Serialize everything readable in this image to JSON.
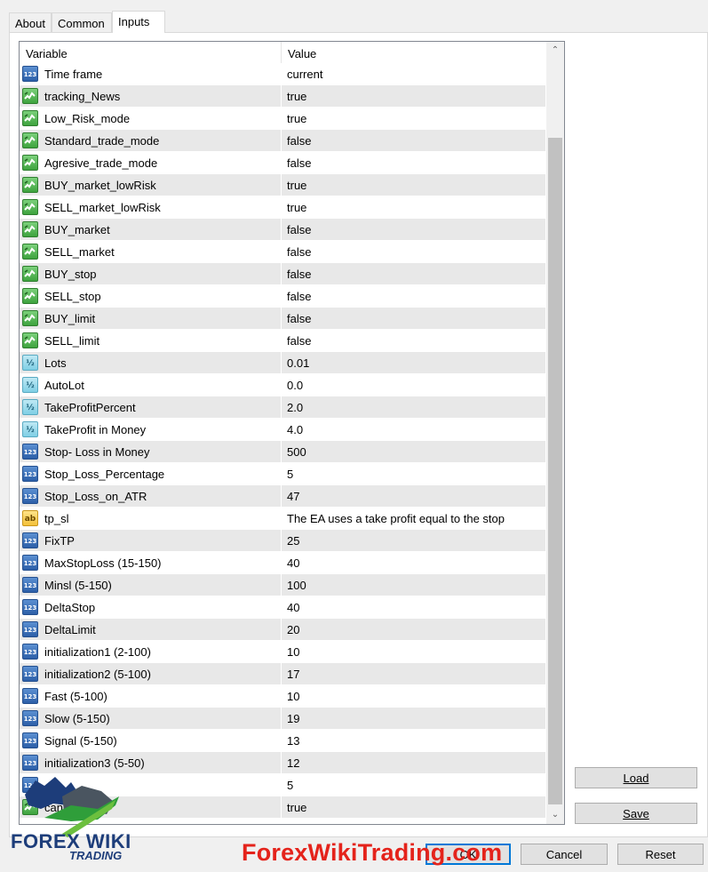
{
  "tabs": [
    "About",
    "Common",
    "Inputs"
  ],
  "table": {
    "headers": {
      "variable": "Variable",
      "value": "Value"
    },
    "rows": [
      {
        "icon": "int",
        "name": "Time frame",
        "value": "current"
      },
      {
        "icon": "bool",
        "name": "tracking_News",
        "value": "true"
      },
      {
        "icon": "bool",
        "name": "Low_Risk_mode",
        "value": "true"
      },
      {
        "icon": "bool",
        "name": "Standard_trade_mode",
        "value": "false"
      },
      {
        "icon": "bool",
        "name": "Agresive_trade_mode",
        "value": "false"
      },
      {
        "icon": "bool",
        "name": "BUY_market_lowRisk",
        "value": "true"
      },
      {
        "icon": "bool",
        "name": "SELL_market_lowRisk",
        "value": "true"
      },
      {
        "icon": "bool",
        "name": "BUY_market",
        "value": "false"
      },
      {
        "icon": "bool",
        "name": "SELL_market",
        "value": "false"
      },
      {
        "icon": "bool",
        "name": "BUY_stop",
        "value": "false"
      },
      {
        "icon": "bool",
        "name": "SELL_stop",
        "value": "false"
      },
      {
        "icon": "bool",
        "name": "BUY_limit",
        "value": "false"
      },
      {
        "icon": "bool",
        "name": "SELL_limit",
        "value": "false"
      },
      {
        "icon": "double",
        "name": "Lots",
        "value": "0.01"
      },
      {
        "icon": "double",
        "name": "AutoLot",
        "value": "0.0"
      },
      {
        "icon": "double",
        "name": "TakeProfitPercent",
        "value": "2.0"
      },
      {
        "icon": "double",
        "name": "TakeProfit in Money",
        "value": "4.0"
      },
      {
        "icon": "int",
        "name": "Stop- Loss in Money",
        "value": "500"
      },
      {
        "icon": "int",
        "name": "Stop_Loss_Percentage",
        "value": "5"
      },
      {
        "icon": "int",
        "name": "Stop_Loss_on_ATR",
        "value": "47"
      },
      {
        "icon": "string",
        "name": "tp_sl",
        "value": "The EA uses a take profit equal to the stop"
      },
      {
        "icon": "int",
        "name": "FixTP",
        "value": "25"
      },
      {
        "icon": "int",
        "name": "MaxStopLoss (15-150)",
        "value": "40"
      },
      {
        "icon": "int",
        "name": "Minsl (5-150)",
        "value": "100"
      },
      {
        "icon": "int",
        "name": "DeltaStop",
        "value": "40"
      },
      {
        "icon": "int",
        "name": "DeltaLimit",
        "value": "20"
      },
      {
        "icon": "int",
        "name": "initialization1 (2-100)",
        "value": "10"
      },
      {
        "icon": "int",
        "name": "initialization2 (5-100)",
        "value": "17"
      },
      {
        "icon": "int",
        "name": "Fast (5-100)",
        "value": "10"
      },
      {
        "icon": "int",
        "name": "Slow (5-150)",
        "value": "19"
      },
      {
        "icon": "int",
        "name": "Signal (5-150)",
        "value": "13"
      },
      {
        "icon": "int",
        "name": "initialization3 (5-50)",
        "value": "12"
      },
      {
        "icon": "int",
        "name": "",
        "value": "5"
      },
      {
        "icon": "bool",
        "name": "candle",
        "value": "true"
      }
    ]
  },
  "icon_glyphs": {
    "int": "123",
    "double": "½",
    "string": "ab"
  },
  "buttons": {
    "load": "Load",
    "save": "Save",
    "ok": "OK",
    "cancel": "Cancel",
    "reset": "Reset"
  },
  "watermark": {
    "text": "ForexWikiTrading.com",
    "logo_name": "FOREX WIKI",
    "logo_sub": "TRADING"
  }
}
